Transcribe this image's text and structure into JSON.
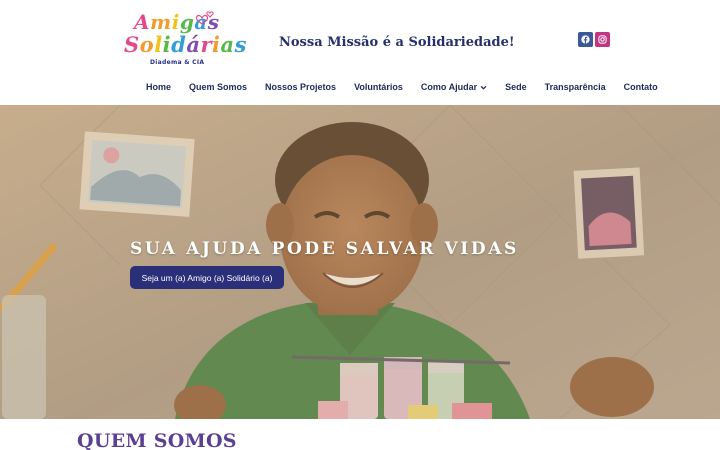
{
  "logo": {
    "line1": "Amigas",
    "line2": "Solidárias",
    "subtitle": "Diadema & CIA",
    "colors": [
      "#e6478a",
      "#f29b2e",
      "#f2c318",
      "#57b947",
      "#2f9fd6",
      "#7c4fb1"
    ]
  },
  "header": {
    "mission": "Nossa Missão é a Solidariedade!"
  },
  "social": [
    {
      "name": "facebook",
      "icon": "facebook-icon",
      "color": "#3b5998"
    },
    {
      "name": "instagram",
      "icon": "instagram-icon",
      "color": "#c13584"
    }
  ],
  "nav": {
    "items": [
      {
        "label": "Home"
      },
      {
        "label": "Quem Somos"
      },
      {
        "label": "Nossos Projetos"
      },
      {
        "label": "Voluntários"
      },
      {
        "label": "Como Ajudar",
        "has_dropdown": true
      },
      {
        "label": "Sede"
      },
      {
        "label": "Transparência"
      },
      {
        "label": "Contato"
      }
    ]
  },
  "hero": {
    "title": "SUA AJUDA PODE SALVAR VIDAS",
    "button_label": "Seja um (a) Amigo (a) Solidário (a)",
    "button_color": "#2b2f7a"
  },
  "section": {
    "title": "QUEM SOMOS",
    "title_color": "#5b3f93"
  }
}
